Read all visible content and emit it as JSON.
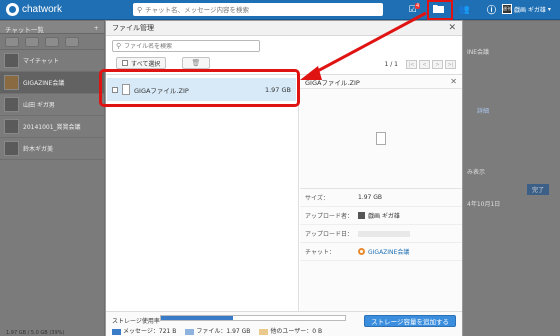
{
  "app": {
    "brand": "chatwork"
  },
  "header": {
    "search_placeholder": "チャット名、メッセージ内容を検索",
    "task_badge": "4",
    "profile_avatar_text": "週刊",
    "profile_name": "戯画 ギガ雄"
  },
  "sidebar": {
    "title": "チャット一覧",
    "rooms": [
      {
        "name": "マイチャット"
      },
      {
        "name": "GIGAZINE会議"
      },
      {
        "name": "山田 ギガ男"
      },
      {
        "name": "20141001_賞賞会議"
      },
      {
        "name": "鈴木ギガ美"
      }
    ]
  },
  "right_panel": {
    "snippets": [
      "INE会議",
      "詳細",
      "み表示",
      "完了",
      "4年10月1日"
    ]
  },
  "modal": {
    "title": "ファイル管理",
    "search_placeholder": "ファイル名を検索",
    "select_all_label": "すべて選択",
    "pager_text": "1 / 1",
    "pager_buttons": [
      "|<",
      "<",
      ">",
      ">|"
    ],
    "files": [
      {
        "name": "GIGAファイル.ZIP",
        "size": "1.97 GB",
        "selected": true
      }
    ],
    "detail": {
      "file_name": "GIGAファイル.ZIP",
      "size_label": "サイズ：",
      "size_value": "1.97 GB",
      "uploader_label": "アップロード者：",
      "uploader_value": "戯画 ギガ雄",
      "date_label": "アップロード日：",
      "chat_label": "チャット：",
      "chat_value": "GIGAZINE会議"
    },
    "footer": {
      "storage_label": "ストレージ使用率",
      "storage_fraction": 0.39,
      "legend": [
        {
          "label": "メッセージ：721 B",
          "color": "#3a7bc8"
        },
        {
          "label": "ファイル：1.97 GB",
          "color": "#8fb3df"
        },
        {
          "label": "他のユーザー：0 B",
          "color": "#e9c98c"
        }
      ],
      "storage_summary": "1.97 GB / 5.0 GB (39%)",
      "add_storage_button": "ストレージ容量を追加する"
    }
  }
}
